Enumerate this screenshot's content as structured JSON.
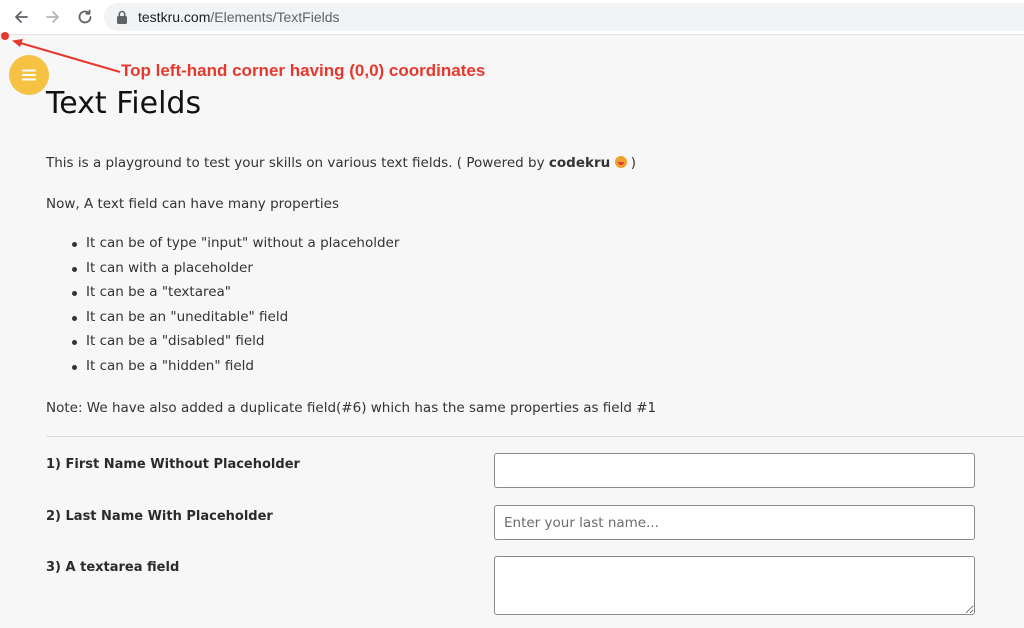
{
  "browser": {
    "url_domain": "testkru.com",
    "url_path": "/Elements/TextFields"
  },
  "annotation": {
    "text": "Top left-hand corner having (0,0) coordinates",
    "color": "#e8382e"
  },
  "page": {
    "title": "Text Fields",
    "intro_prefix": "This is a playground to test your skills on various text fields. ( Powered by ",
    "intro_brand": "codekru",
    "intro_suffix": " )",
    "properties_intro": "Now, A text field can have many properties",
    "properties": [
      "It can be of type \"input\" without a placeholder",
      "It can with a placeholder",
      "It can be a \"textarea\"",
      "It can be an \"uneditable\" field",
      "It can be a \"disabled\" field",
      "It can be a \"hidden\" field"
    ],
    "note": "Note: We have also added a duplicate field(#6) which has the same properties as field #1"
  },
  "fields": [
    {
      "label": "1) First Name Without Placeholder",
      "value": "",
      "placeholder": ""
    },
    {
      "label": "2) Last Name With Placeholder",
      "value": "",
      "placeholder": "Enter your last name..."
    },
    {
      "label": "3) A textarea field",
      "value": "",
      "placeholder": ""
    }
  ],
  "icons": {
    "back": "arrow-left-icon",
    "forward": "arrow-right-icon",
    "reload": "reload-icon",
    "lock": "lock-icon",
    "menu": "hamburger-menu-icon",
    "emoji": "tongue-face-emoji-icon"
  },
  "colors": {
    "menu_button": "#f6c244",
    "page_background": "#f7f7f7"
  }
}
